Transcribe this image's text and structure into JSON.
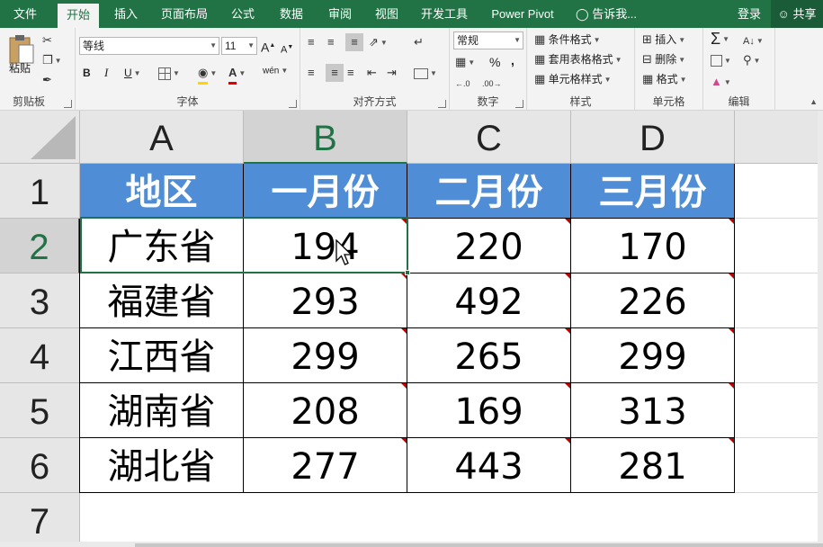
{
  "menu": {
    "tabs": [
      {
        "label": "文件"
      },
      {
        "label": "开始",
        "active": true
      },
      {
        "label": "插入"
      },
      {
        "label": "页面布局"
      },
      {
        "label": "公式"
      },
      {
        "label": "数据"
      },
      {
        "label": "审阅"
      },
      {
        "label": "视图"
      },
      {
        "label": "开发工具"
      },
      {
        "label": "Power Pivot"
      }
    ],
    "tell_me": "告诉我...",
    "login": "登录",
    "share": "共享"
  },
  "ribbon": {
    "clipboard": {
      "label": "剪贴板",
      "paste": "粘贴"
    },
    "font": {
      "label": "字体",
      "name": "等线",
      "size": "11",
      "bold": "B",
      "italic": "I",
      "underline": "U",
      "grow": "A",
      "shrink": "A",
      "color_letter": "A",
      "phonetic": "wén"
    },
    "alignment": {
      "label": "对齐方式"
    },
    "number": {
      "label": "数字",
      "format": "常规",
      "percent": "%",
      "comma": ","
    },
    "styles": {
      "label": "样式",
      "conditional": "条件格式",
      "table": "套用表格格式",
      "cell": "单元格样式"
    },
    "cells": {
      "label": "单元格",
      "insert": "插入",
      "delete": "删除",
      "format": "格式"
    },
    "editing": {
      "label": "编辑"
    }
  },
  "sheet": {
    "columns": [
      "A",
      "B",
      "C",
      "D"
    ],
    "rows": [
      "1",
      "2",
      "3",
      "4",
      "5",
      "6",
      "7"
    ],
    "header": [
      "地区",
      "一月份",
      "二月份",
      "三月份"
    ],
    "data": [
      [
        "广东省",
        "194",
        "220",
        "170"
      ],
      [
        "福建省",
        "293",
        "492",
        "226"
      ],
      [
        "江西省",
        "299",
        "265",
        "299"
      ],
      [
        "湖南省",
        "208",
        "169",
        "313"
      ],
      [
        "湖北省",
        "277",
        "443",
        "281"
      ]
    ],
    "selected_cell": "B2",
    "accent": "#217346",
    "header_fill": "#4f8ed6",
    "error_marker": "#c00000"
  }
}
